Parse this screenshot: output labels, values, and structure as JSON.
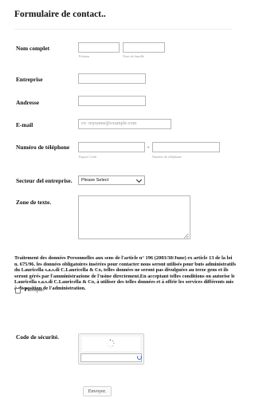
{
  "form": {
    "title": "Formulaire de contact.."
  },
  "fields": {
    "full_name": {
      "label": "Nom complet",
      "first_sub": "Prénom",
      "last_sub": "Nom de famille"
    },
    "company": {
      "label": "Entreprise"
    },
    "address": {
      "label": "Andresse"
    },
    "email": {
      "label": "E-mail",
      "placeholder": "ex: myname@example.com"
    },
    "phone": {
      "label": "Numéro de téléphone",
      "separator": "-",
      "area_sub": "Espace Code",
      "number_sub": "Numéro de téléphone"
    },
    "sector": {
      "label": "Secteur del entreprise.",
      "selected": "Please Select"
    },
    "message": {
      "label": "Zone de texte."
    },
    "security": {
      "label": "Code de sécurité."
    }
  },
  "legal": {
    "text": "Traitement des données Personnelles aux sens de l'article n° 196 (2003/30/June) ex article 13 de la loi n. 675/96. les données obligatoires insérées pour contacter nous seront utilisés pour buts administratifs du Lauricella s.a.s.di C.Lauricella & Co, telles données ne seront pas divulguées au terze gens et ils seront gérés par l'amministrazione de l'usine directement.En acceptant telles conditions on autorise le Lauricella s.a.s.di C.Lauricella & Co, à utiliser des telles données et à offrir les services différents mis à disposition de l'administration.",
    "accept_label": "J'accepte."
  },
  "submit": {
    "label": "Envoyer."
  },
  "icons": {
    "spinner": "loading-spinner-icon",
    "refresh": "refresh-icon",
    "dropdown": "chevron-down-icon",
    "resize": "resize-grip-icon"
  },
  "colors": {
    "refresh": "#3b6fd1",
    "input_border": "#b8b8b8"
  }
}
